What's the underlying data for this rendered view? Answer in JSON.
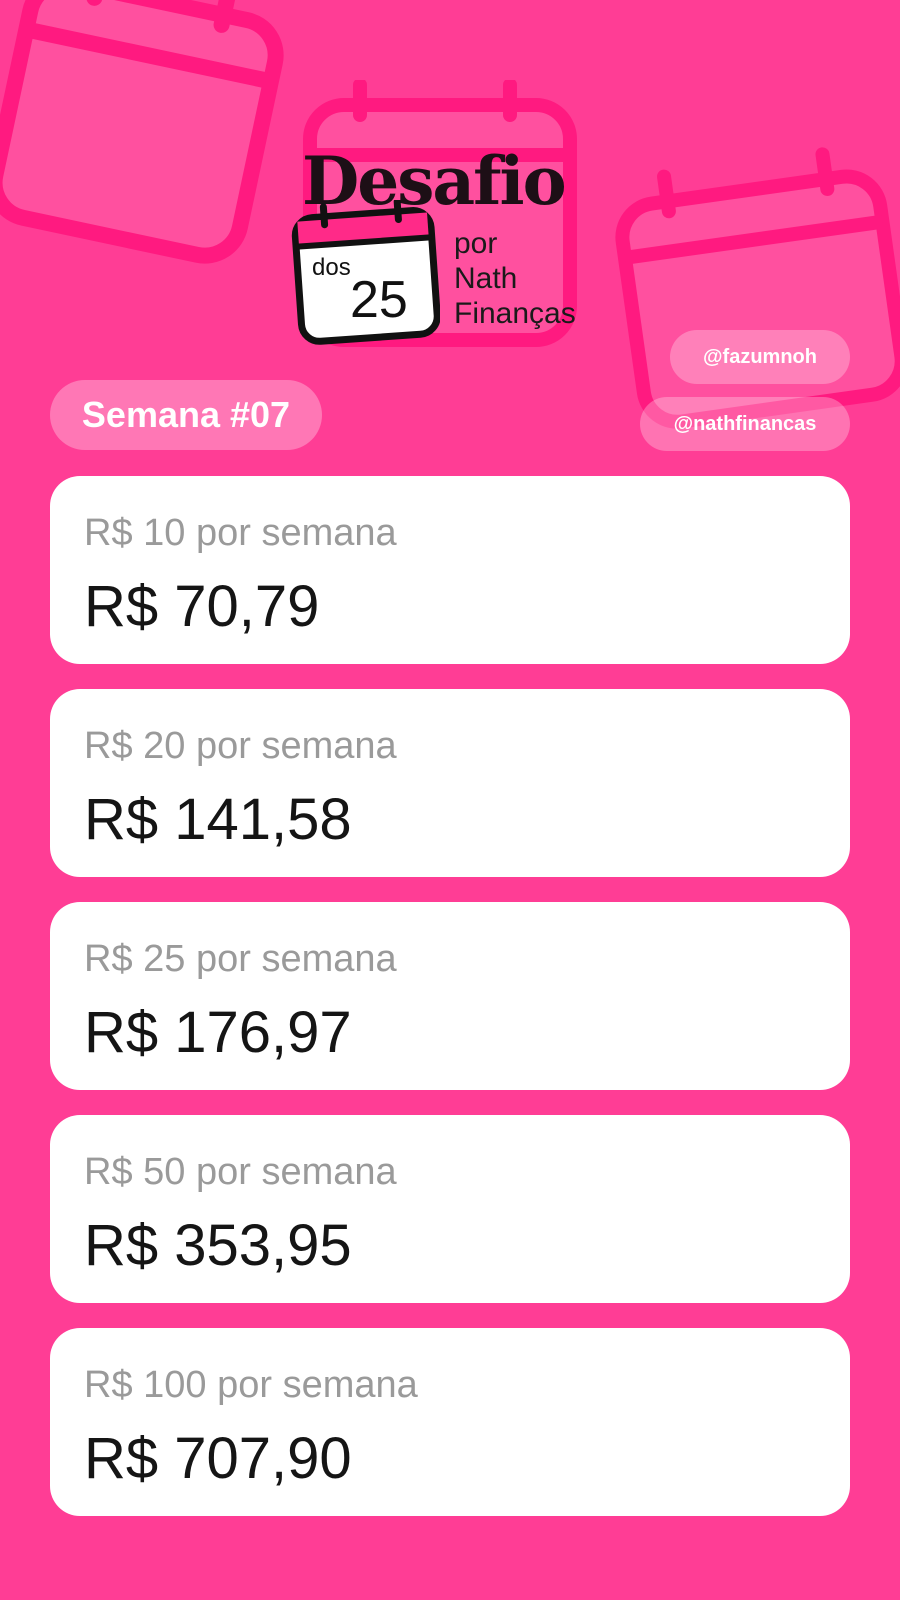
{
  "brand": {
    "title": "Desafio",
    "calendar_top": "dos",
    "calendar_number": "25",
    "byline": [
      "por",
      "Nath",
      "Finanças"
    ]
  },
  "handles": [
    "@fazumnoh",
    "@nathfinancas"
  ],
  "week_label": "Semana #07",
  "cards": [
    {
      "label": "R$ 10 por semana",
      "amount": "R$ 70,79"
    },
    {
      "label": "R$ 20 por semana",
      "amount": "R$ 141,58"
    },
    {
      "label": "R$ 25 por semana",
      "amount": "R$ 176,97"
    },
    {
      "label": "R$ 50 por semana",
      "amount": "R$ 353,95"
    },
    {
      "label": "R$ 100 por semana",
      "amount": "R$ 707,90"
    }
  ],
  "colors": {
    "background": "#ff3d95",
    "card": "#ffffff",
    "accent": "#ff2a88"
  },
  "icons": [
    "calendar-icon"
  ]
}
